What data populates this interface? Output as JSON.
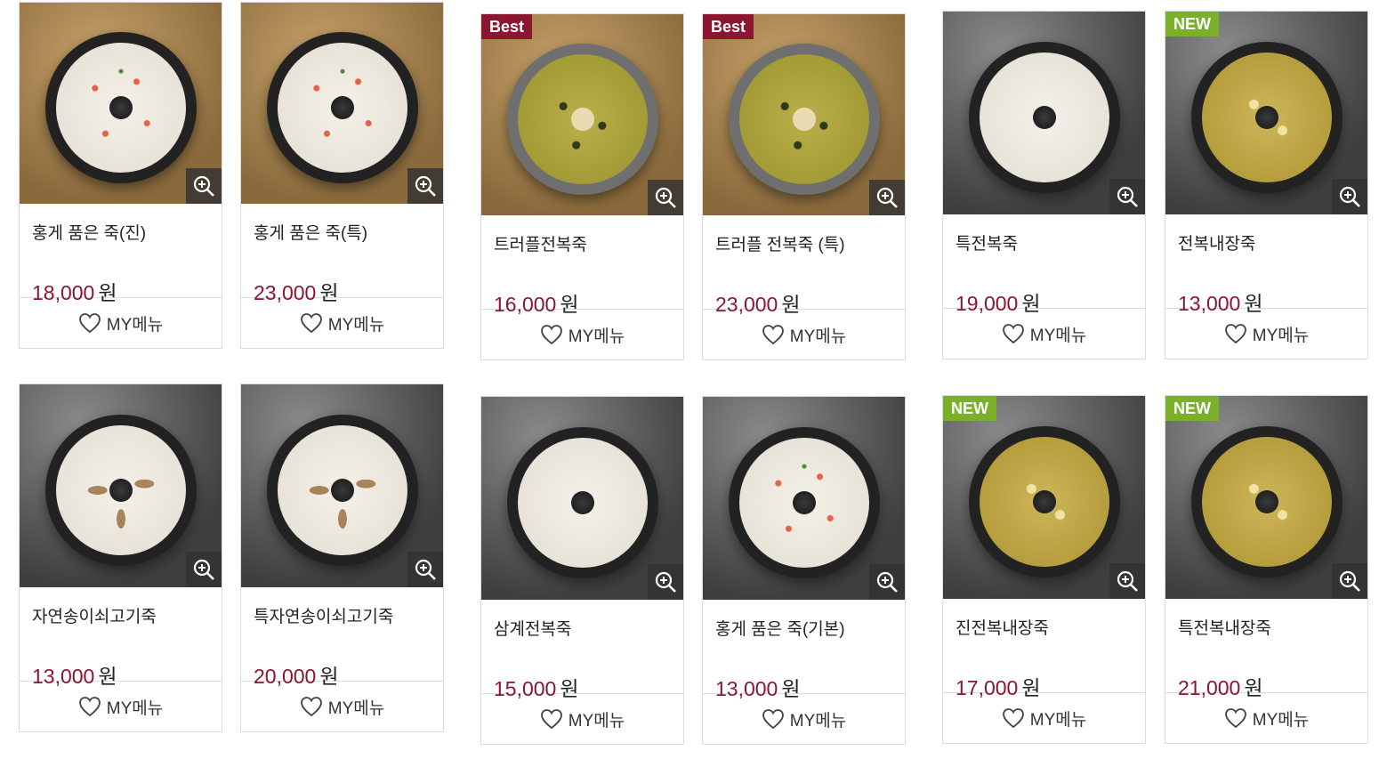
{
  "colors": {
    "accent": "#8a1631",
    "best_badge": "#8a1631",
    "new_badge": "#7ab02a"
  },
  "mymenu_label": "MY메뉴",
  "price_unit": "원",
  "products": [
    {
      "name": "홍게 품은 죽(진)",
      "price": "18,000",
      "badge": ""
    },
    {
      "name": "홍게 품은 죽(특)",
      "price": "23,000",
      "badge": ""
    },
    {
      "name": "트러플전복죽",
      "price": "16,000",
      "badge": "Best"
    },
    {
      "name": "트러플 전복죽 (특)",
      "price": "23,000",
      "badge": "Best"
    },
    {
      "name": "특전복죽",
      "price": "19,000",
      "badge": ""
    },
    {
      "name": "전복내장죽",
      "price": "13,000",
      "badge": "NEW"
    },
    {
      "name": "자연송이쇠고기죽",
      "price": "13,000",
      "badge": ""
    },
    {
      "name": "특자연송이쇠고기죽",
      "price": "20,000",
      "badge": ""
    },
    {
      "name": "삼계전복죽",
      "price": "15,000",
      "badge": ""
    },
    {
      "name": "홍게 품은 죽(기본)",
      "price": "13,000",
      "badge": ""
    },
    {
      "name": "진전복내장죽",
      "price": "17,000",
      "badge": "NEW"
    },
    {
      "name": "특전복내장죽",
      "price": "21,000",
      "badge": "NEW"
    }
  ],
  "icons": {
    "zoom": "zoom-in-icon",
    "heart": "heart-icon"
  }
}
